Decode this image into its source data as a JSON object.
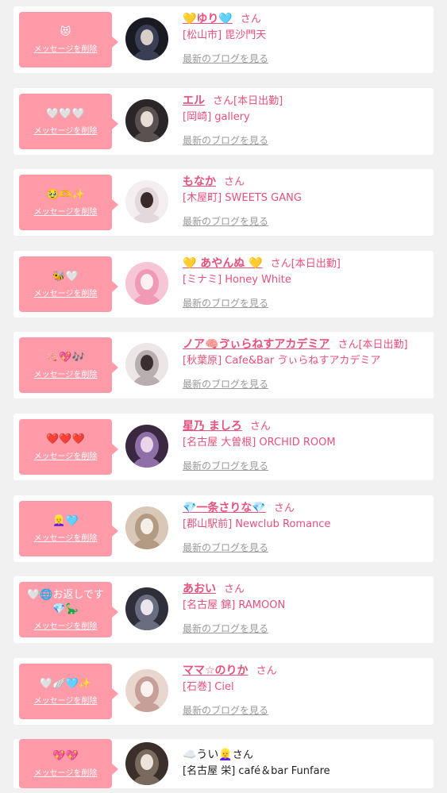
{
  "colors": {
    "accent": "#e8507c",
    "bubble": "#ff9aa8",
    "link_gray": "#9a9a9a",
    "background": "#f1f1f1"
  },
  "messages": [
    {
      "emoji": "😻",
      "delete_label": "メッセージを削除",
      "name": "💛ゆり🩵",
      "suffix": "さん",
      "tag": "",
      "shop": "[松山市] 毘沙門天",
      "blog_label": "最新のブログを見る"
    },
    {
      "emoji": "🤍🤍🤍",
      "delete_label": "メッセージを削除",
      "name": "エル",
      "suffix": "さん",
      "tag": "[本日出勤]",
      "shop": "[岡崎] gallery",
      "blog_label": "最新のブログを見る"
    },
    {
      "emoji": "🥹🫶✨",
      "delete_label": "メッセージを削除",
      "name": "もなか",
      "suffix": "さん",
      "tag": "",
      "shop": "[木屋町] SWEETS GANG",
      "blog_label": "最新のブログを見る"
    },
    {
      "emoji": "🐝🤍",
      "delete_label": "メッセージを削除",
      "name": "💛 あやんぬ 💛",
      "suffix": "さん",
      "tag": "[本日出勤]",
      "shop": "[ミナミ] Honey White",
      "blog_label": "最新のブログを見る"
    },
    {
      "emoji": "🧠💖🎶",
      "delete_label": "メッセージを削除",
      "name": "ノア🧠ゔぃらねすアカデミア",
      "suffix": "さん",
      "tag": "[本日出勤]",
      "shop": "[秋葉原] Cafe&Bar ゔぃらねすアカデミア",
      "blog_label": "最新のブログを見る"
    },
    {
      "emoji": "❤️❤️❤️",
      "delete_label": "メッセージを削除",
      "name": "星乃 ましろ",
      "suffix": "さん",
      "tag": "",
      "shop": "[名古屋 大曽根] ORCHID ROOM",
      "blog_label": "最新のブログを見る"
    },
    {
      "emoji": "👱‍♀️🩵",
      "delete_label": "メッセージを削除",
      "name": "💎一条さりな💎",
      "suffix": "さん",
      "tag": "",
      "shop": "[郡山駅前] Newclub Romance",
      "blog_label": "最新のブログを見る"
    },
    {
      "emoji": "🤍🌐お返しです💎🦕",
      "delete_label": "メッセージを削除",
      "name": "あおい",
      "suffix": "さん",
      "tag": "",
      "shop": "[名古屋 錦] RAMOON",
      "blog_label": "最新のブログを見る"
    },
    {
      "emoji": "🤍🪽🩵✨",
      "delete_label": "メッセージを削除",
      "name": "ママ☆のりか",
      "suffix": "さん",
      "tag": "",
      "shop": "[石巻] Ciel",
      "blog_label": "最新のブログを見る"
    },
    {
      "emoji": "💖💖",
      "delete_label": "メッセージを削除",
      "name": "☁️うい👱‍♀️",
      "suffix": "さん",
      "tag": "",
      "shop": "[名古屋 栄] café＆bar Funfare",
      "blog_label": ""
    }
  ]
}
